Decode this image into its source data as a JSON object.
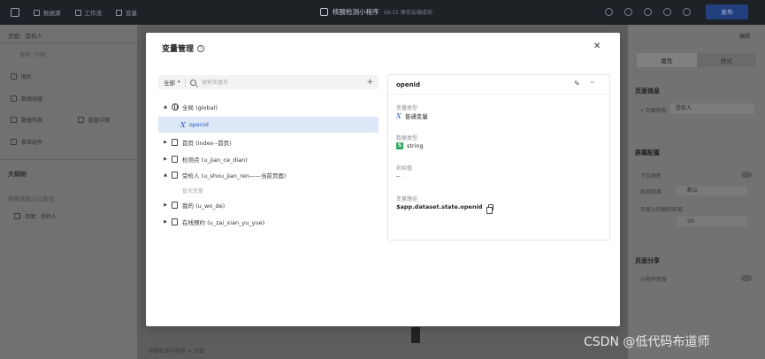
{
  "topbar": {
    "tabs": [
      {
        "label": "数据源",
        "icon": "database-icon"
      },
      {
        "label": "工作流",
        "icon": "workflow-icon"
      },
      {
        "label": "变量",
        "icon": "function-icon"
      }
    ],
    "app_title": "核酸检测小程序",
    "save_status": "16:15 保存云端成功",
    "publish_label": "发布"
  },
  "left_panel": {
    "page_selector": "页面：受检人",
    "search_placeholder": "搜索一切组",
    "items": [
      "图片",
      "数据容器",
      "数据列表",
      "数据详情",
      "表单组件"
    ],
    "outline_title": "大纲树",
    "outline_search": "搜索或输入以查找",
    "outline_root": "页面：受检人"
  },
  "right_panel": {
    "tab_property": "属性",
    "tab_style": "样式",
    "section_page_info": "页面信息",
    "page_name_label": "• 页面名称",
    "page_name_value": "受检人",
    "section_page_config": "屏幕配置",
    "pull_refresh": "下拉刷新",
    "bottom_distance_label": "底部距离",
    "bottom_distance_value": "默认",
    "reach_bottom_label": "页面上拉触底距离",
    "reach_bottom_value": "50",
    "section_share": "页面分享",
    "share_enable": "小程序转发"
  },
  "canvas": {
    "top_right_label": "编辑",
    "breadcrumb": "核酸检测小程序 > 页面"
  },
  "modal": {
    "title": "变量管理",
    "filter_all": "全部",
    "search_placeholder": "搜索变量名",
    "tree": [
      {
        "label": "全局 (global)",
        "type": "global",
        "expanded": true
      },
      {
        "label": "openid",
        "type": "var",
        "selected": true
      },
      {
        "label": "首页 (index--首页)",
        "type": "page"
      },
      {
        "label": "检测点 (u_jian_ce_dian)",
        "type": "page"
      },
      {
        "label": "受检人 (u_shou_jian_ren——当前页面)",
        "type": "page",
        "expanded": true
      },
      {
        "label": "暂无变量",
        "type": "empty"
      },
      {
        "label": "我的 (u_wo_de)",
        "type": "page"
      },
      {
        "label": "在线预约 (u_zai_xian_yu_yue)",
        "type": "page"
      }
    ],
    "detail": {
      "name": "openid",
      "var_type_label": "变量类型",
      "var_type_value": "普通变量",
      "data_type_label": "数据类型",
      "data_type_value": "string",
      "initial_label": "初始值",
      "initial_value": "--",
      "path_label": "变量路径",
      "path_value": "$app.dataset.state.openid"
    }
  },
  "watermark": "CSDN @低代码布道师",
  "colors": {
    "accent": "#2b5fc2",
    "selected_bg": "#dce7f7",
    "string_badge": "#2aa55f"
  }
}
